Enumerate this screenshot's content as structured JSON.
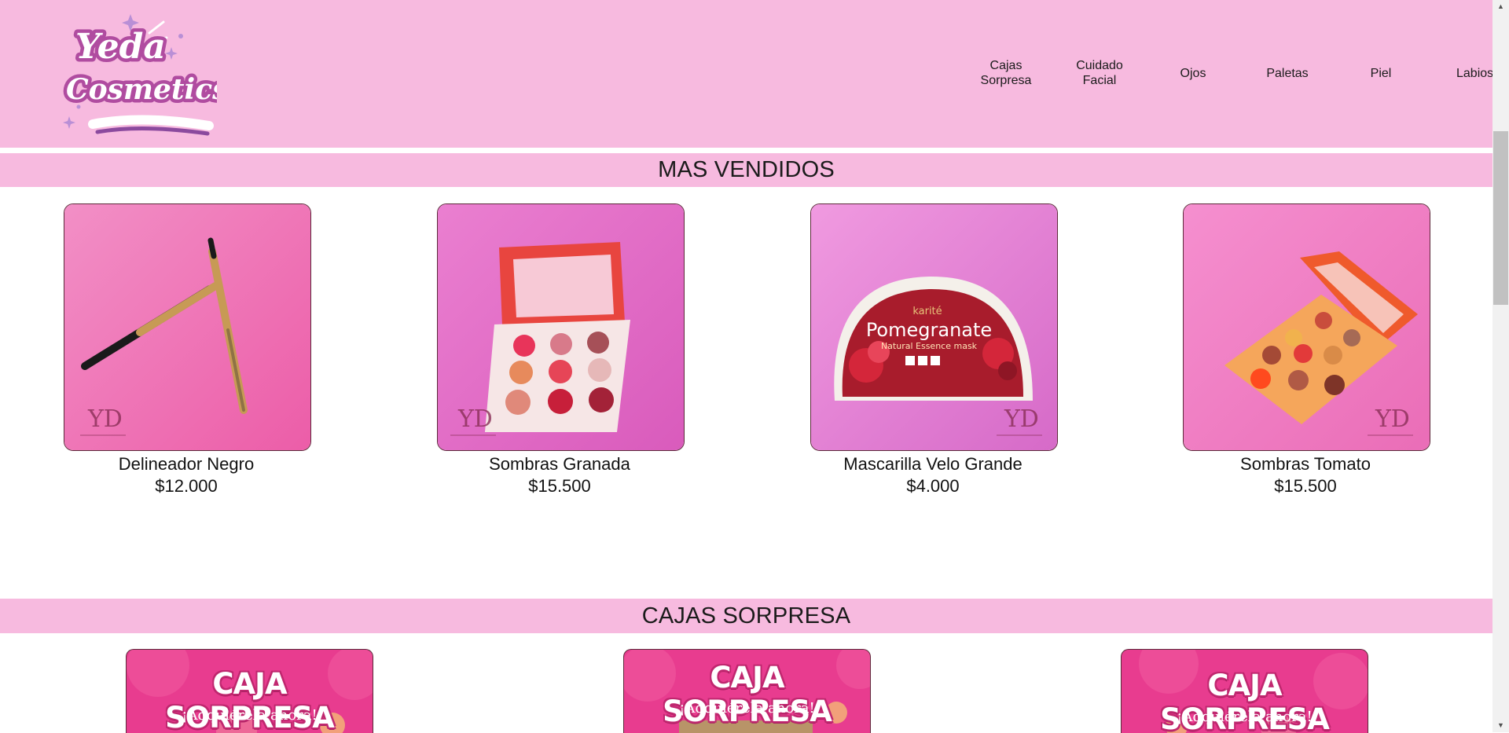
{
  "brand": {
    "logo_line1": "Yeda",
    "logo_line2": "Cosmetics"
  },
  "nav": {
    "cajas_sorpresa": [
      "Cajas",
      "Sorpresa"
    ],
    "cuidado_facial": [
      "Cuidado",
      "Facial"
    ],
    "ojos": "Ojos",
    "paletas": "Paletas",
    "piel": "Piel",
    "labios": "Labios"
  },
  "sections": {
    "best_sellers": "MAS VENDIDOS",
    "surprise_boxes": "CAJAS SORPRESA"
  },
  "products": [
    {
      "name": "Delineador Negro",
      "price": "$12.000",
      "watermark": "YD"
    },
    {
      "name": "Sombras Granada",
      "price": "$15.500",
      "watermark": "YD"
    },
    {
      "name": "Mascarilla Velo Grande",
      "price": "$4.000",
      "watermark": "YD",
      "pack_brand": "karité",
      "pack_title": "Pomegranate",
      "pack_subtitle": "Natural Essence mask"
    },
    {
      "name": "Sombras Tomato",
      "price": "$15.500",
      "watermark": "YD"
    }
  ],
  "boxes": [
    {
      "title": "CAJA SORPRESA",
      "subtitle": "¡Adquiérela ahora!"
    },
    {
      "title": "CAJA SORPRESA",
      "subtitle": "¡Adquiérela ahora!"
    },
    {
      "title": "CAJA SORPRESA",
      "subtitle": "¡Adquiérela ahora!"
    }
  ],
  "colors": {
    "header_bg": "#f7badf",
    "banner_bg": "#e83c8f",
    "photo_bg": "#f07ec0"
  }
}
